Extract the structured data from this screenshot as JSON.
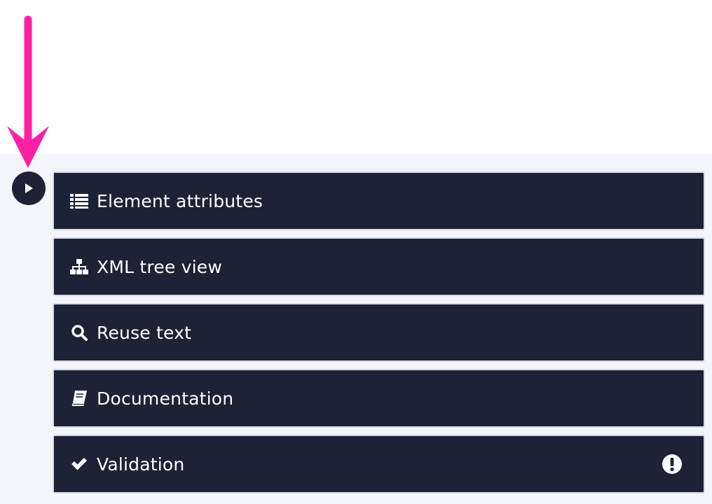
{
  "colors": {
    "panel_background": "#1d2236",
    "panel_border": "#d7dae3",
    "sidebar_background": "#f4f5fa",
    "text": "#ffffff",
    "pointer_arrow": "#ff1fa5"
  },
  "annotation": {
    "icon": "down-arrow-icon"
  },
  "toggle": {
    "icon": "play-icon"
  },
  "panels": [
    {
      "label": "Element attributes",
      "icon": "list-icon"
    },
    {
      "label": "XML tree view",
      "icon": "sitemap-icon"
    },
    {
      "label": "Reuse text",
      "icon": "search-icon"
    },
    {
      "label": "Documentation",
      "icon": "book-icon"
    },
    {
      "label": "Validation",
      "icon": "check-icon",
      "status_icon": "exclamation-circle-icon"
    }
  ]
}
